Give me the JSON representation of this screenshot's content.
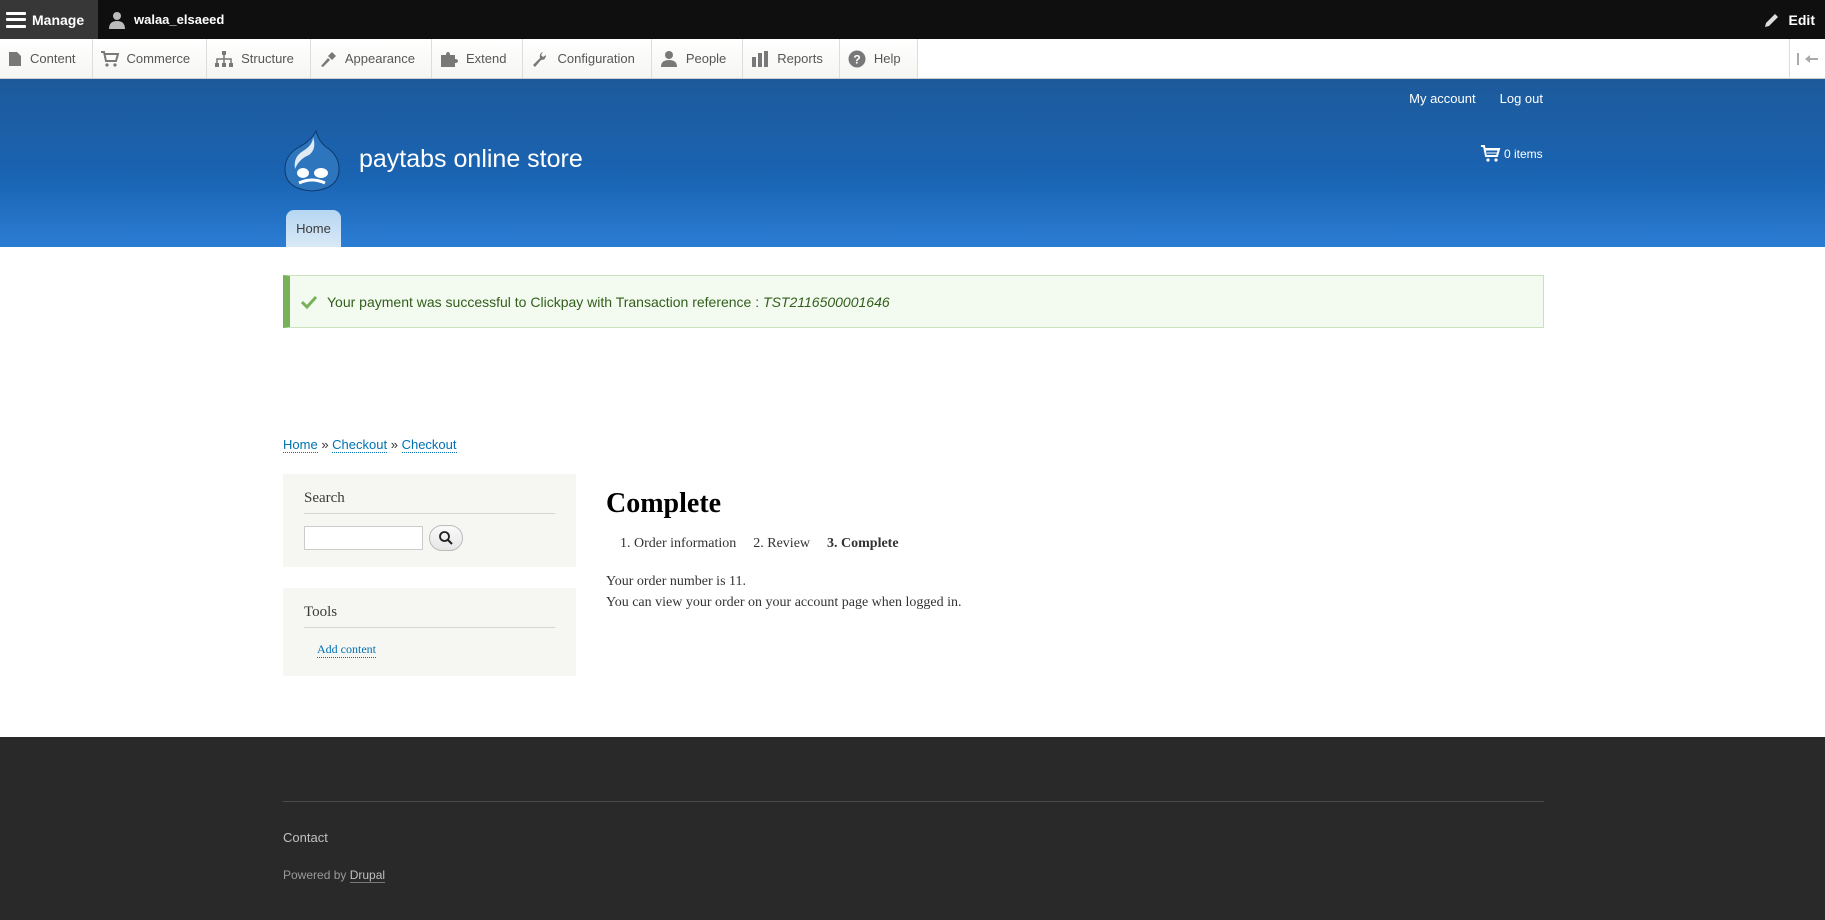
{
  "toolbar": {
    "manage_label": "Manage",
    "user_name": "walaa_elsaeed",
    "edit_label": "Edit"
  },
  "tray": {
    "items": [
      {
        "label": "Content",
        "icon": "content-icon"
      },
      {
        "label": "Commerce",
        "icon": "cart-icon"
      },
      {
        "label": "Structure",
        "icon": "structure-icon"
      },
      {
        "label": "Appearance",
        "icon": "paintbrush-icon"
      },
      {
        "label": "Extend",
        "icon": "puzzle-icon"
      },
      {
        "label": "Configuration",
        "icon": "wrench-icon"
      },
      {
        "label": "People",
        "icon": "person-icon"
      },
      {
        "label": "Reports",
        "icon": "bar-chart-icon"
      },
      {
        "label": "Help",
        "icon": "help-icon"
      }
    ]
  },
  "header": {
    "my_account": "My account",
    "log_out": "Log out",
    "site_name": "paytabs online store",
    "cart_label": "0 items",
    "main_tab": "Home"
  },
  "status": {
    "text": "Your payment was successful to Clickpay with Transaction reference : ",
    "reference": "TST2116500001646"
  },
  "breadcrumb": {
    "items": [
      "Home",
      "Checkout",
      "Checkout"
    ],
    "separator": "»"
  },
  "sidebar": {
    "search_title": "Search",
    "tools_title": "Tools",
    "tools_link": "Add content"
  },
  "main": {
    "title": "Complete",
    "steps": [
      "1. Order information",
      "2. Review",
      "3. Complete"
    ],
    "line1": "Your order number is 11.",
    "line2": "You can view your order on your account page when logged in."
  },
  "footer": {
    "contact": "Contact",
    "powered_prefix": "Powered by ",
    "powered_link": "Drupal"
  },
  "colors": {
    "header_blue": "#1a64b3",
    "status_green": "#77b259",
    "link_blue": "#0071b3",
    "footer_bg": "#292929"
  }
}
